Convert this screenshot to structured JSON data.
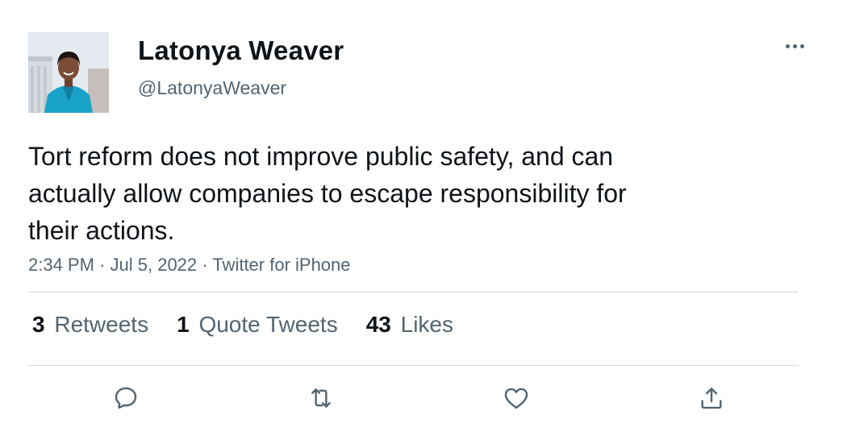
{
  "author": {
    "display_name": "Latonya Weaver",
    "handle": "@LatonyaWeaver",
    "avatar_icon": "profile-photo"
  },
  "tweet": {
    "text": "Tort reform does not improve public safety, and can\nactually allow companies to escape responsibility for\ntheir actions.",
    "time": "2:34 PM",
    "date": "Jul 5, 2022",
    "source": "Twitter for iPhone",
    "separator": "·"
  },
  "stats": {
    "retweets_count": "3",
    "retweets_label": "Retweets",
    "quotes_count": "1",
    "quotes_label": "Quote Tweets",
    "likes_count": "43",
    "likes_label": "Likes"
  },
  "actions": [
    "reply-icon",
    "retweet-icon",
    "like-icon",
    "share-icon"
  ],
  "colors": {
    "text_primary": "#0f1419",
    "text_secondary": "#536471",
    "divider": "#cfd9de",
    "icon": "#536471"
  }
}
